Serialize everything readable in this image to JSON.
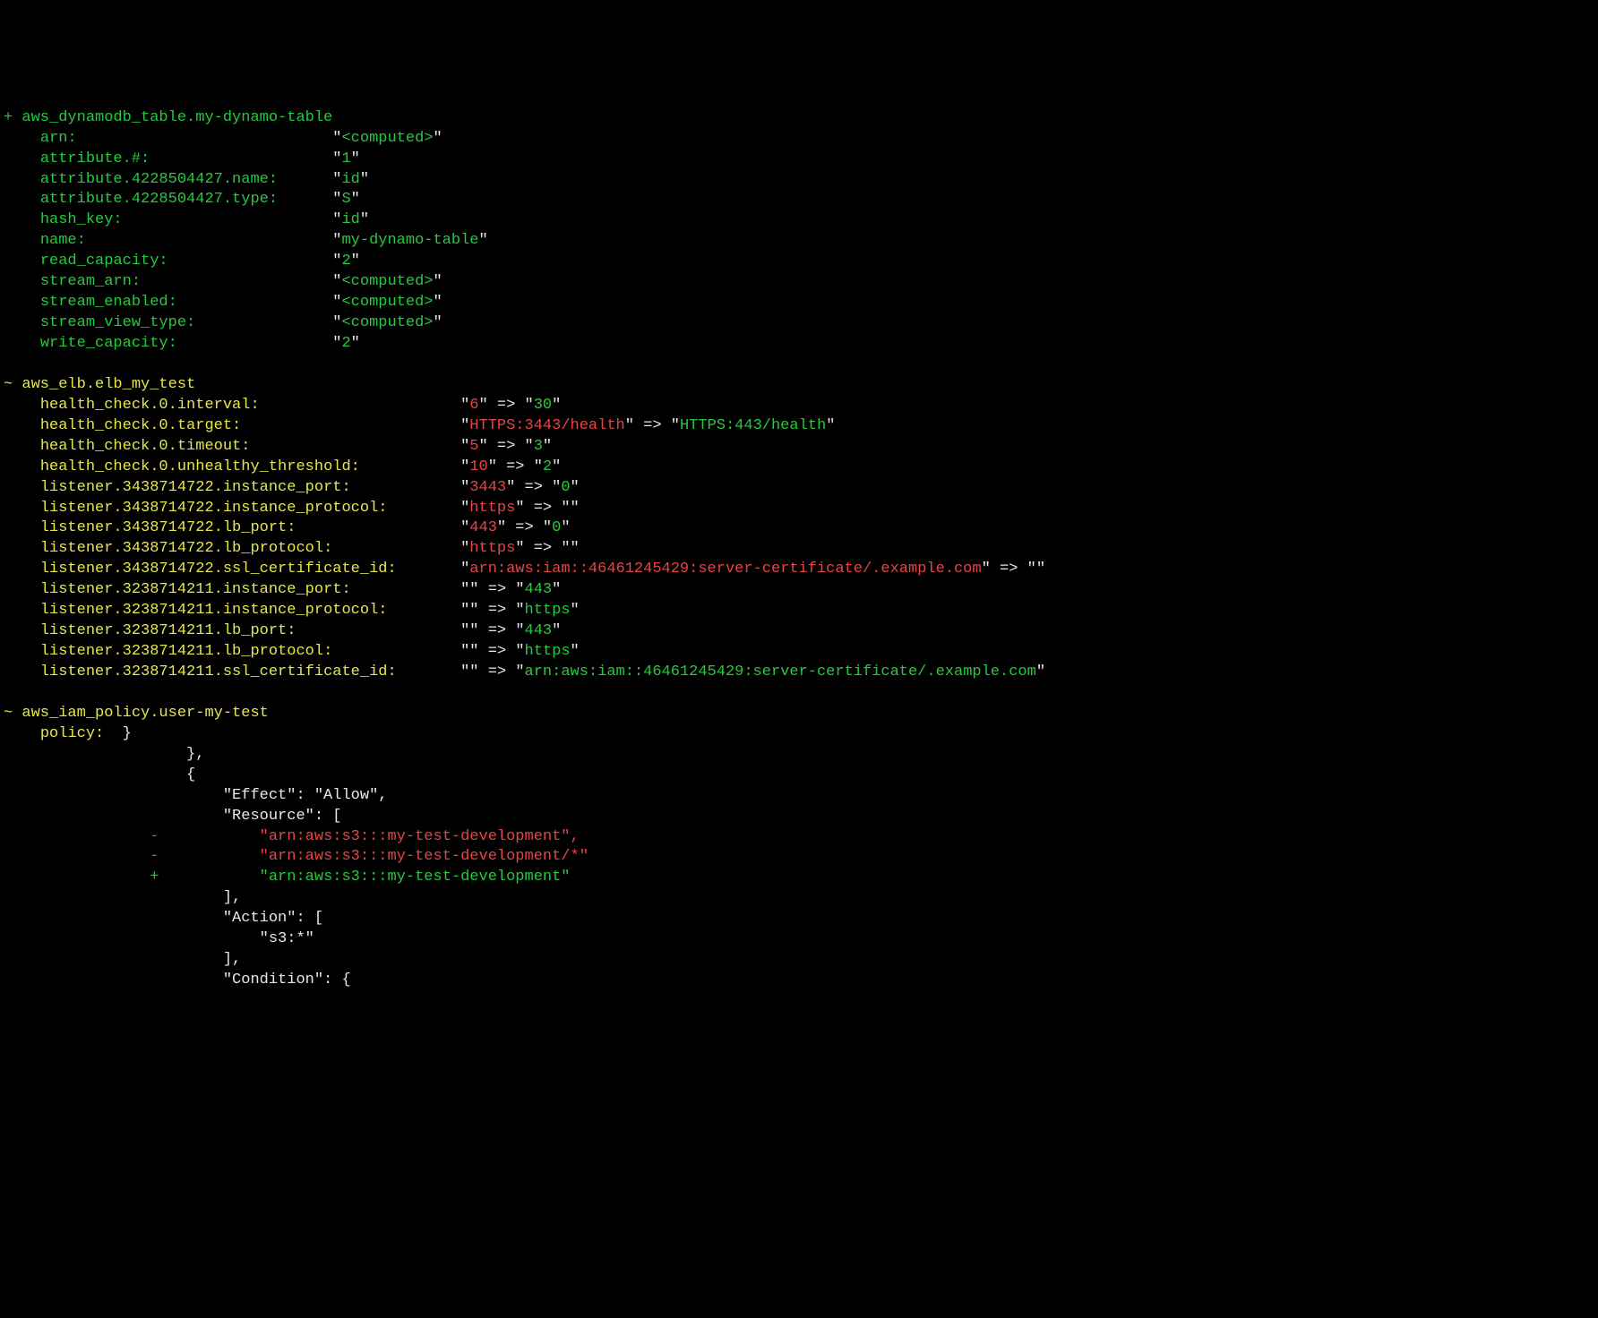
{
  "blocks": [
    {
      "marker": "+",
      "marker_color": "g",
      "title": "aws_dynamodb_table.my-dynamo-table",
      "title_color": "g",
      "attr_col": 36,
      "attr_color": "g",
      "val_color": "g",
      "attrs": [
        {
          "key": "arn:",
          "value": "<computed>"
        },
        {
          "key": "attribute.#:",
          "value": "1"
        },
        {
          "key": "attribute.4228504427.name:",
          "value": "id"
        },
        {
          "key": "attribute.4228504427.type:",
          "value": "S"
        },
        {
          "key": "hash_key:",
          "value": "id"
        },
        {
          "key": "name:",
          "value": "my-dynamo-table"
        },
        {
          "key": "read_capacity:",
          "value": "2"
        },
        {
          "key": "stream_arn:",
          "value": "<computed>"
        },
        {
          "key": "stream_enabled:",
          "value": "<computed>"
        },
        {
          "key": "stream_view_type:",
          "value": "<computed>"
        },
        {
          "key": "write_capacity:",
          "value": "2"
        }
      ]
    },
    {
      "marker": "~",
      "marker_color": "y",
      "title": "aws_elb.elb_my_test",
      "title_color": "y",
      "attr_col": 50,
      "attr_color": "y",
      "changes": [
        {
          "key": "health_check.0.interval:",
          "old": "6",
          "new": "30"
        },
        {
          "key": "health_check.0.target:",
          "old": "HTTPS:3443/health",
          "new": "HTTPS:443/health"
        },
        {
          "key": "health_check.0.timeout:",
          "old": "5",
          "new": "3"
        },
        {
          "key": "health_check.0.unhealthy_threshold:",
          "old": "10",
          "new": "2"
        },
        {
          "key": "listener.3438714722.instance_port:",
          "old": "3443",
          "new": "0"
        },
        {
          "key": "listener.3438714722.instance_protocol:",
          "old": "https",
          "new": ""
        },
        {
          "key": "listener.3438714722.lb_port:",
          "old": "443",
          "new": "0"
        },
        {
          "key": "listener.3438714722.lb_protocol:",
          "old": "https",
          "new": ""
        },
        {
          "key": "listener.3438714722.ssl_certificate_id:",
          "old": "arn:aws:iam::46461245429:server-certificate/.example.com",
          "new": ""
        },
        {
          "key": "listener.3238714211.instance_port:",
          "old": "",
          "new": "443"
        },
        {
          "key": "listener.3238714211.instance_protocol:",
          "old": "",
          "new": "https"
        },
        {
          "key": "listener.3238714211.lb_port:",
          "old": "",
          "new": "443"
        },
        {
          "key": "listener.3238714211.lb_protocol:",
          "old": "",
          "new": "https"
        },
        {
          "key": "listener.3238714211.ssl_certificate_id:",
          "old": "",
          "new": "arn:aws:iam::46461245429:server-certificate/.example.com"
        }
      ]
    },
    {
      "marker": "~",
      "marker_color": "y",
      "title": "aws_iam_policy.user-my-test",
      "title_color": "y",
      "policy_diff": {
        "attr_label": "policy:",
        "attr_color": "y",
        "lines": [
          {
            "text": "}",
            "indent": 13,
            "diff": " "
          },
          {
            "text": "},",
            "indent": 20,
            "diff": " "
          },
          {
            "text": "{",
            "indent": 20,
            "diff": " "
          },
          {
            "text": "\"Effect\": \"Allow\",",
            "indent": 24,
            "diff": " "
          },
          {
            "text": "\"Resource\": [",
            "indent": 24,
            "diff": " "
          },
          {
            "text": "\"arn:aws:s3:::my-test-development\",",
            "indent": 28,
            "diff": "-"
          },
          {
            "text": "\"arn:aws:s3:::my-test-development/*\"",
            "indent": 28,
            "diff": "-"
          },
          {
            "text": "\"arn:aws:s3:::my-test-development\"",
            "indent": 28,
            "diff": "+"
          },
          {
            "text": "],",
            "indent": 24,
            "diff": " "
          },
          {
            "text": "\"Action\": [",
            "indent": 24,
            "diff": " "
          },
          {
            "text": "\"s3:*\"",
            "indent": 28,
            "diff": " "
          },
          {
            "text": "],",
            "indent": 24,
            "diff": " "
          },
          {
            "text": "\"Condition\": {",
            "indent": 24,
            "diff": " "
          }
        ]
      }
    }
  ]
}
